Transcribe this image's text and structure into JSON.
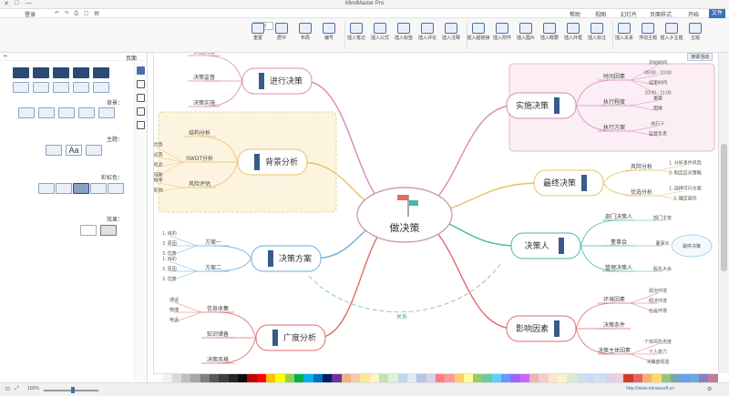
{
  "app": {
    "title": "MindMaster Pro",
    "window_controls": [
      "—",
      "□",
      "✕"
    ]
  },
  "menu": {
    "items": [
      "文件",
      "开始",
      "页面样式",
      "幻灯片",
      "视图",
      "帮助"
    ],
    "active_index": 0,
    "right_label": "登录"
  },
  "ribbon": {
    "buttons": [
      "主题",
      "插入子主题",
      "浮动主题",
      "插入关系",
      "插入标注",
      "插入外框",
      "插入概要",
      "插入图片",
      "插入附件",
      "插入超链接",
      "插入注释",
      "插入评论",
      "插入标签",
      "插入公式",
      "插入笔记",
      "编号",
      "布局",
      "居中",
      "重置"
    ],
    "spinner_values": [
      "30",
      "30"
    ]
  },
  "left_panel": {
    "title": "页面",
    "sections": {
      "layout": "布局：",
      "theme": "主题：",
      "background": "背景：",
      "branch": "彩虹色：",
      "effect": "效果："
    }
  },
  "canvas": {
    "tab_label": "演讲活动",
    "central_topic": "做决策",
    "branches": [
      {
        "label": "实施决策",
        "color": "#d98cb3",
        "children": [
          {
            "label": "时间因素",
            "items": [
              "开始时间",
              "09:00 - 10:00",
              "结束时间",
              "10:00 - 11:00"
            ]
          },
          {
            "label": "执行程度",
            "items": [
              "重要",
              "困难"
            ]
          },
          {
            "label": "执行方案",
            "items": [
              "执行人",
              "监督负责"
            ]
          }
        ]
      },
      {
        "label": "最终决策",
        "color": "#e7c06a",
        "children": [
          {
            "label": "风险分析",
            "items": [
              "1. 分析事件风险",
              "2. 制定应对策略"
            ]
          },
          {
            "label": "优选分析",
            "items": [
              "1. 选择可行方案",
              "2. 确定最优"
            ]
          }
        ]
      },
      {
        "label": "决策人",
        "color": "#4bb5a8",
        "children": [
          {
            "label": "部门决策人",
            "items": [
              "部门主管"
            ]
          },
          {
            "label": "董事会",
            "items": [
              "董事长"
            ]
          },
          {
            "label": "管理决策人",
            "items": [
              "股东大会"
            ]
          }
        ],
        "callout": "最终决策"
      },
      {
        "label": "影响因素",
        "color": "#e06a6a",
        "children": [
          {
            "label": "环境因素",
            "items": [
              "政治环境",
              "经济环境",
              "社会环境"
            ]
          },
          {
            "label": "决策条件",
            "items": []
          },
          {
            "label": "决策主体因素",
            "items": [
              "个体风险态度",
              "个人能力",
              "决策者经验"
            ]
          }
        ]
      },
      {
        "label": "进行决策",
        "color": "#d98cb3",
        "children": [
          {
            "label": "实施决策"
          },
          {
            "label": "决策监督"
          },
          {
            "label": "决策实施"
          }
        ]
      },
      {
        "label": "背景分析",
        "color": "#e7c06a",
        "children": [
          {
            "label": "结构分析"
          },
          {
            "label": "SWOT分析",
            "items": [
              "1. 优势",
              "2. 劣势",
              "3. 机会",
              "4. 威胁"
            ]
          },
          {
            "label": "风险评估",
            "items": [
              "1. 概率",
              "2. 影响"
            ]
          }
        ]
      },
      {
        "label": "决策方案",
        "color": "#6aaedb",
        "children": [
          {
            "label": "方案一",
            "items": [
              "1. 目的",
              "2. 原因",
              "3. 优势"
            ]
          },
          {
            "label": "方案二",
            "items": [
              "1. 目的",
              "2. 原因",
              "3. 优势"
            ]
          }
        ]
      },
      {
        "label": "广度分析",
        "color": "#e06a6a",
        "children": [
          {
            "label": "信息收集",
            "items": [
              "通话",
              "微博",
              "电话"
            ]
          },
          {
            "label": "知识储备"
          },
          {
            "label": "决策风格"
          }
        ]
      }
    ],
    "relation_label": "关系"
  },
  "palette": {
    "colors": [
      "#ffffff",
      "#f2f2f2",
      "#d9d9d9",
      "#bfbfbf",
      "#a6a6a6",
      "#7f7f7f",
      "#595959",
      "#3f3f3f",
      "#262626",
      "#0d0d0d",
      "#c00000",
      "#ff0000",
      "#ffc000",
      "#ffff00",
      "#92d050",
      "#00b050",
      "#00b0f0",
      "#0070c0",
      "#002060",
      "#7030a0",
      "#f4b183",
      "#f8cbad",
      "#ffe699",
      "#fff2cc",
      "#c5e0b4",
      "#e2f0d9",
      "#bdd7ee",
      "#deebf7",
      "#b4c7e7",
      "#d9d2e9",
      "#ff7c80",
      "#ff9999",
      "#ffcc66",
      "#ffff99",
      "#99cc66",
      "#66cc99",
      "#66ccff",
      "#6699ff",
      "#9966ff",
      "#cc66ff",
      "#e6b8af",
      "#f4cccc",
      "#fce5cd",
      "#fff2cc",
      "#d9ead3",
      "#d0e0e3",
      "#c9daf8",
      "#cfe2f3",
      "#d9d2e9",
      "#ead1dc",
      "#cc4125",
      "#e06666",
      "#f6b26b",
      "#ffd966",
      "#93c47d",
      "#76a5af",
      "#6d9eeb",
      "#6fa8dc",
      "#8e7cc3",
      "#c27ba0"
    ]
  },
  "status": {
    "url": "http://www.edrawsoft.cn",
    "zoom": "100%"
  }
}
